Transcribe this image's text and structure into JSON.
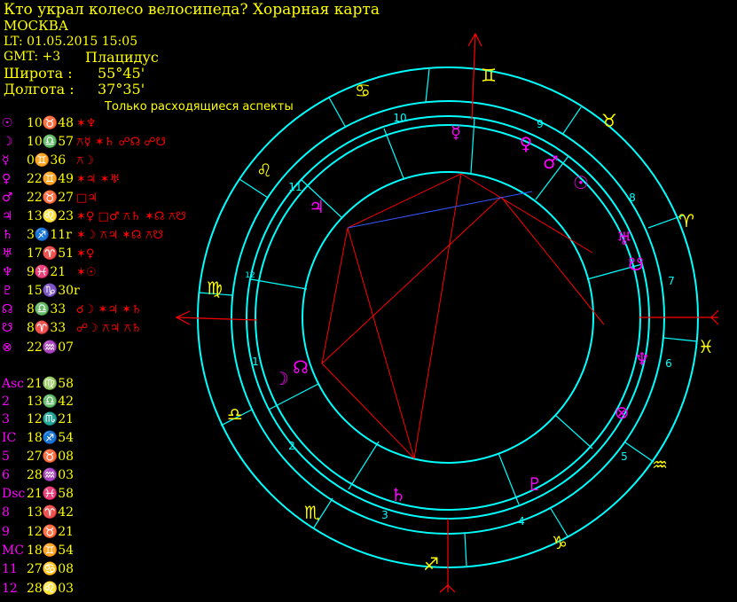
{
  "header": {
    "title": "Кто украл колесо велосипеда? Хорарная карта",
    "city": "МОСКВА",
    "lt": "LT: 01.05.2015  15:05",
    "gmt": "GMT: +3",
    "system": "Плацидус",
    "lat_label": "Широта :",
    "lat_value": "55°45'",
    "lon_label": "Долгота :",
    "lon_value": "37°35'",
    "aspects_title": "Только расходящиеся аспекты"
  },
  "planets": [
    {
      "glyph": "☉",
      "pos": "10♉48",
      "aspects": "✶♆"
    },
    {
      "glyph": "☽",
      "pos": "10♎57",
      "aspects": "⚻☿ ✶♄ ☍☊ ☍☋"
    },
    {
      "glyph": "☿",
      "pos": "0♊36",
      "aspects": "⚻☽"
    },
    {
      "glyph": "♀",
      "pos": "22♊49",
      "aspects": "✶♃ ✶♅"
    },
    {
      "glyph": "♂",
      "pos": "22♉27",
      "aspects": "□♃"
    },
    {
      "glyph": "♃",
      "pos": "13♌23",
      "aspects": "✶♀ □♂ ⚻♄ ✶☊ ⚻☋"
    },
    {
      "glyph": "♄",
      "pos": "3♐11r",
      "aspects": "✶☽ ⚻♃ ✶☊ ⚻☋"
    },
    {
      "glyph": "♅",
      "pos": "17♈51",
      "aspects": "✶♀"
    },
    {
      "glyph": "♆",
      "pos": "9♓21",
      "aspects": "✶☉"
    },
    {
      "glyph": "♇",
      "pos": "15♑30r",
      "aspects": ""
    },
    {
      "glyph": "☊",
      "pos": "8♎33",
      "aspects": "☌☽ ✶♃ ✶♄"
    },
    {
      "glyph": "☋",
      "pos": "8♈33",
      "aspects": "☍☽ ⚻♃ ⚻♄"
    },
    {
      "glyph": "⊗",
      "pos": "22♒07",
      "aspects": ""
    }
  ],
  "houses": [
    {
      "label": "Asc",
      "pos": "21♍58"
    },
    {
      "label": "2",
      "pos": "13♎42"
    },
    {
      "label": "3",
      "pos": "12♏21"
    },
    {
      "label": "IC",
      "pos": "18♐54"
    },
    {
      "label": "5",
      "pos": "27♉08"
    },
    {
      "label": "6",
      "pos": "28♒03"
    },
    {
      "label": "Dsc",
      "pos": "21♓58"
    },
    {
      "label": "8",
      "pos": "13♈42"
    },
    {
      "label": "9",
      "pos": "12♉21"
    },
    {
      "label": "MC",
      "pos": "18♊54"
    },
    {
      "label": "11",
      "pos": "27♋08"
    },
    {
      "label": "12",
      "pos": "28♌03"
    }
  ],
  "wheel": {
    "signs": [
      "♊",
      "♉",
      "♈",
      "♓",
      "♒",
      "♑",
      "♐",
      "♏",
      "♎",
      "♍",
      "♌",
      "♋"
    ],
    "house_numbers": [
      "10",
      "9",
      "8",
      "7",
      "6",
      "5",
      "4",
      "3",
      "2",
      "1",
      "12",
      "11"
    ],
    "planet_glyphs": [
      "☿",
      "♀",
      "♂",
      "☉",
      "♅",
      "☋",
      "♆",
      "⊗",
      "♇",
      "♄",
      "☽",
      "☊",
      "♃"
    ]
  },
  "colors": {
    "circle": "#00ffff",
    "sign": "#ffff00",
    "planet": "#ff00ff",
    "aspect_red": "#ff0000",
    "aspect_blue": "#3355ff",
    "axis": "#ff0000"
  }
}
